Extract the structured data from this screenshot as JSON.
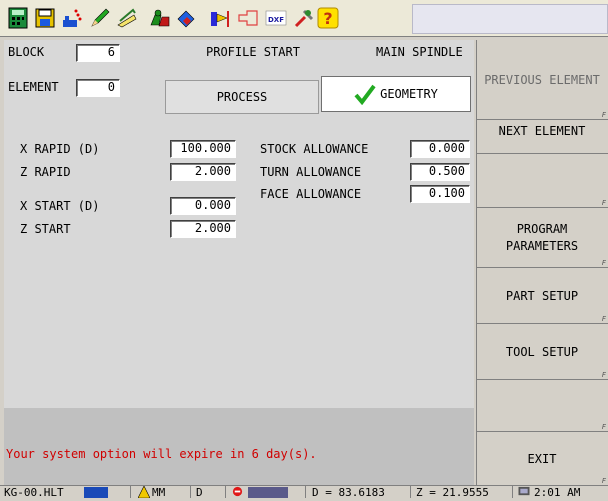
{
  "toolbar": {
    "icons": [
      "calculator-icon",
      "save-disk-icon",
      "tool-dots-icon",
      "pencil-icon",
      "draw-icon",
      "chess-pieces-icon",
      "paint-bucket-icon",
      "arrow-block-icon",
      "profile-outline-icon",
      "dxf-icon",
      "tools-icon",
      "help-icon"
    ],
    "dxf_label": "DXF"
  },
  "header": {
    "block_label": "BLOCK",
    "block_value": "6",
    "profile_start": "PROFILE START",
    "main_spindle": "MAIN SPINDLE",
    "element_label": "ELEMENT",
    "element_value": "0"
  },
  "tabs": {
    "process": "PROCESS",
    "geometry": "GEOMETRY",
    "active": "geometry"
  },
  "fields": {
    "x_rapid_label": "X RAPID (D)",
    "x_rapid_value": "100.000",
    "z_rapid_label": "Z RAPID",
    "z_rapid_value": "2.000",
    "x_start_label": "X START (D)",
    "x_start_value": "0.000",
    "z_start_label": "Z START",
    "z_start_value": "2.000",
    "stock_allowance_label": "STOCK ALLOWANCE",
    "stock_allowance_value": "0.000",
    "turn_allowance_label": "TURN ALLOWANCE",
    "turn_allowance_value": "0.500",
    "face_allowance_label": "FACE ALLOWANCE",
    "face_allowance_value": "0.100"
  },
  "message": "Your system option will expire in 6 day(s).",
  "softkeys": [
    {
      "label": "PREVIOUS ELEMENT",
      "enabled": false
    },
    {
      "label": "NEXT ELEMENT",
      "enabled": true
    },
    {
      "label": "",
      "enabled": true
    },
    {
      "label": "PROGRAM PARAMETERS",
      "enabled": true
    },
    {
      "label": "PART SETUP",
      "enabled": true
    },
    {
      "label": "TOOL SETUP",
      "enabled": true
    },
    {
      "label": "",
      "enabled": true
    },
    {
      "label": "EXIT",
      "enabled": true
    }
  ],
  "softkey_marker": "F",
  "status": {
    "filename": "KG-00.HLT",
    "units": "MM",
    "mode": "D",
    "d_readout": "D = 83.6183",
    "z_readout": "Z = 21.9555",
    "time": "2:01 AM"
  },
  "colors": {
    "message": "#d00000",
    "checkmark": "#22aa22"
  }
}
